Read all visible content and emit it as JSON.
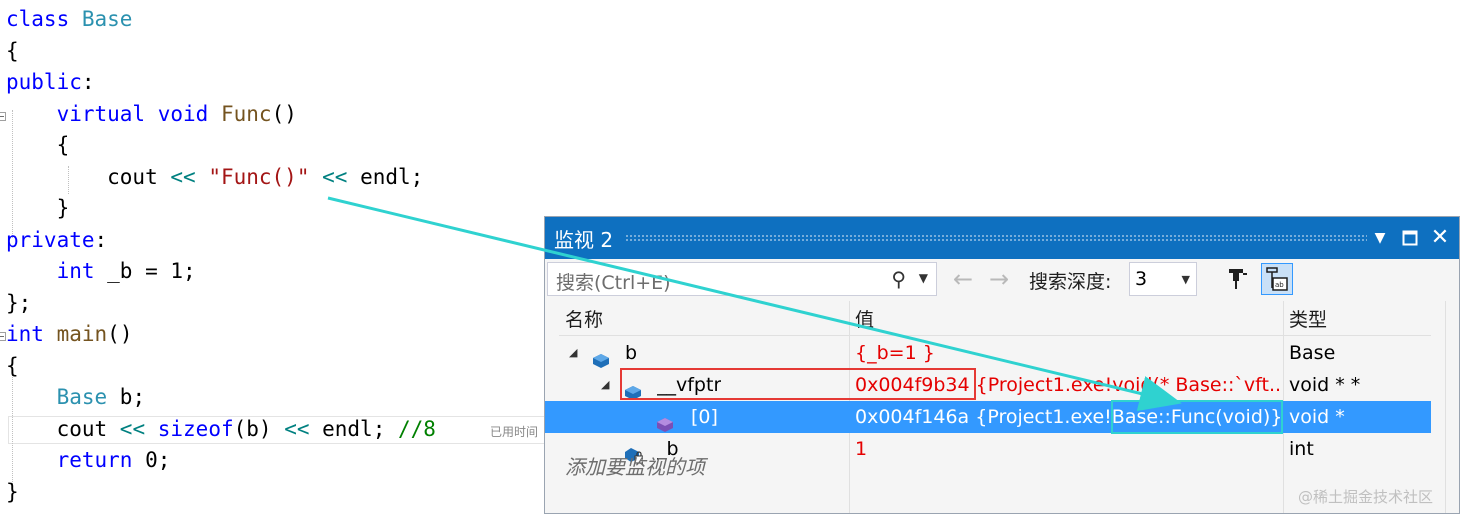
{
  "code": {
    "lines": [
      [
        {
          "t": "class",
          "c": "kw"
        },
        {
          "t": " "
        },
        {
          "t": "Base",
          "c": "ty"
        }
      ],
      [
        {
          "t": "{"
        }
      ],
      [
        {
          "t": "public",
          "c": "kw"
        },
        {
          "t": ":"
        }
      ],
      [
        {
          "t": "    "
        },
        {
          "t": "virtual",
          "c": "kw"
        },
        {
          "t": " "
        },
        {
          "t": "void",
          "c": "kw"
        },
        {
          "t": " "
        },
        {
          "t": "Func",
          "c": "fn"
        },
        {
          "t": "()"
        }
      ],
      [
        {
          "t": "    {"
        }
      ],
      [
        {
          "t": "        cout "
        },
        {
          "t": "<<",
          "c": "op"
        },
        {
          "t": " "
        },
        {
          "t": "\"Func()\"",
          "c": "str"
        },
        {
          "t": " "
        },
        {
          "t": "<<",
          "c": "op"
        },
        {
          "t": " endl;"
        }
      ],
      [
        {
          "t": "    }"
        }
      ],
      [
        {
          "t": "private",
          "c": "kw"
        },
        {
          "t": ":"
        }
      ],
      [
        {
          "t": "    "
        },
        {
          "t": "int",
          "c": "kw"
        },
        {
          "t": " _b = 1;"
        }
      ],
      [
        {
          "t": "};"
        }
      ],
      [
        {
          "t": "int",
          "c": "kw"
        },
        {
          "t": " "
        },
        {
          "t": "main",
          "c": "fn"
        },
        {
          "t": "()"
        }
      ],
      [
        {
          "t": "{"
        }
      ],
      [
        {
          "t": "    "
        },
        {
          "t": "Base",
          "c": "ty"
        },
        {
          "t": " b;"
        }
      ],
      [
        {
          "t": "    cout "
        },
        {
          "t": "<<",
          "c": "op"
        },
        {
          "t": " "
        },
        {
          "t": "sizeof",
          "c": "kw"
        },
        {
          "t": "(b) "
        },
        {
          "t": "<<",
          "c": "op"
        },
        {
          "t": " endl; "
        },
        {
          "t": "//8",
          "c": "cm"
        }
      ],
      [
        {
          "t": "    "
        },
        {
          "t": "return",
          "c": "kw"
        },
        {
          "t": " 0;"
        }
      ],
      [
        {
          "t": "}"
        }
      ]
    ],
    "elapsed_hint": "已用时间"
  },
  "watch": {
    "title": "监视 2",
    "search_placeholder": "搜索(Ctrl+E)",
    "depth_label": "搜索深度:",
    "depth_value": "3",
    "columns": {
      "name": "名称",
      "value": "值",
      "type": "类型"
    },
    "rows": [
      {
        "name": "b",
        "value": "{_b=1 }",
        "type": "Base",
        "expand": "expanded",
        "icon": "object-icon",
        "value_color": "#e50000"
      },
      {
        "name": "__vfptr",
        "value": "0x004f9b34 {Project1.exe!void(* Base::`vft...",
        "type": "void * *",
        "expand": "expanded",
        "icon": "object-icon",
        "value_color": "#e50000"
      },
      {
        "name": "[0]",
        "value": "0x004f146a {Project1.exe!Base::Func(void)}",
        "type": "void *",
        "expand": "none",
        "icon": "pointer-item-icon",
        "selected": true
      },
      {
        "name": "_b",
        "value": "1",
        "type": "int",
        "expand": "none",
        "icon": "private-field-icon",
        "value_color": "#e50000"
      }
    ],
    "add_item_hint": "添加要监视的项"
  },
  "annotations": {
    "arrow_color": "#2fd2d0",
    "red_box_color": "#e53935"
  },
  "watermark": "@稀土掘金技术社区"
}
